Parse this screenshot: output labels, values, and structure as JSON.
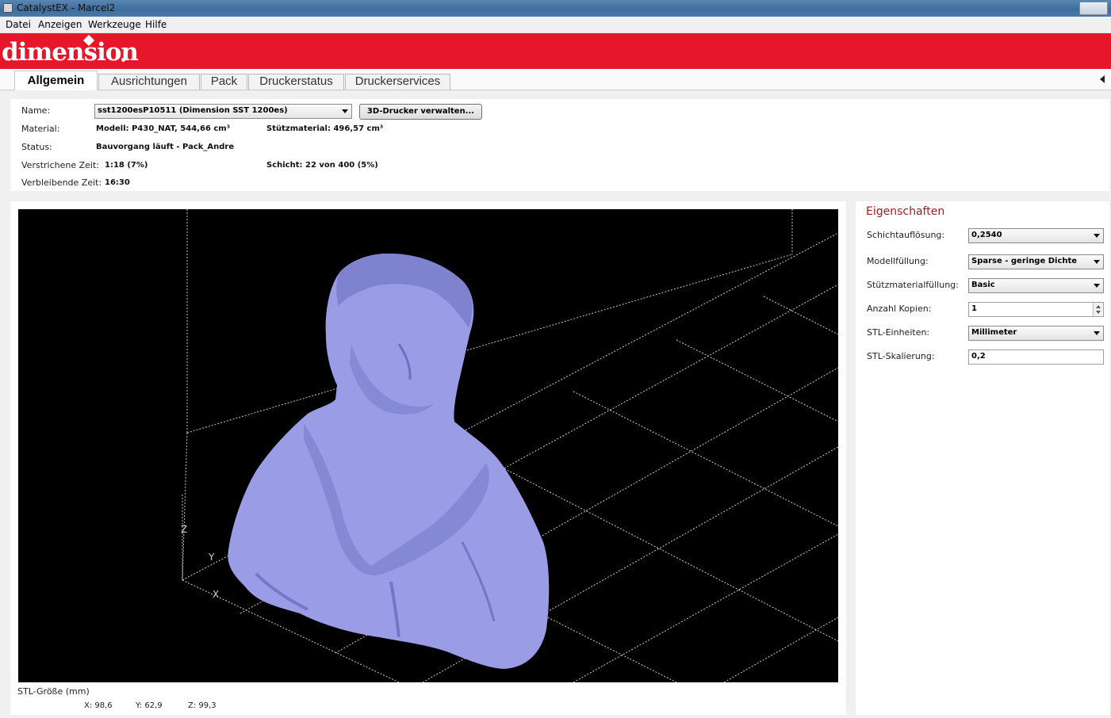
{
  "window": {
    "title": "CatalystEX - Marcel2"
  },
  "menu": [
    "Datei",
    "Anzeigen",
    "Werkzeuge",
    "Hilfe"
  ],
  "brand": {
    "logo_text": "dimension",
    "color": "#e8162a"
  },
  "tabs": [
    {
      "label": "Allgemein",
      "active": true
    },
    {
      "label": "Ausrichtungen",
      "active": false
    },
    {
      "label": "Pack",
      "active": false
    },
    {
      "label": "Druckerstatus",
      "active": false
    },
    {
      "label": "Druckerservices",
      "active": false
    }
  ],
  "general": {
    "name_label": "Name:",
    "printer_select": "sst1200esP10511  (Dimension SST 1200es)",
    "manage_button": "3D-Drucker verwalten...",
    "material_label": "Material:",
    "model_material": "Modell: P430_NAT,  544,66 cm³",
    "support_material": "Stützmaterial: 496,57 cm³",
    "status_label": "Status:",
    "status_value": "Bauvorgang läuft  - Pack_Andre",
    "elapsed_label": "Verstrichene Zeit:",
    "elapsed_value": "1:18  (7%)",
    "layer_value": "Schicht: 22 von 400  (5%)",
    "remaining_label": "Verbleibende Zeit:",
    "remaining_value": "16:30"
  },
  "viewer": {
    "axis_z": "Z",
    "axis_y": "Y",
    "axis_x": "X",
    "model_color": "#9a9ce6",
    "stl_size_label": "STL-Größe (mm)",
    "size_x": "X:  98,6",
    "size_y": "Y:  62,9",
    "size_z": "Z:  99,3"
  },
  "properties": {
    "title": "Eigenschaften",
    "rows": [
      {
        "label": "Schichtauflösung:",
        "value": "0,2540"
      },
      {
        "label": "Modellfüllung:",
        "value": "Sparse - geringe Dichte"
      },
      {
        "label": "Stützmaterialfüllung:",
        "value": "Basic"
      },
      {
        "label": "Anzahl Kopien:",
        "value": "1"
      },
      {
        "label": "STL-Einheiten:",
        "value": "Millimeter"
      },
      {
        "label": "STL-Skalierung:",
        "value": "0,2"
      }
    ]
  }
}
